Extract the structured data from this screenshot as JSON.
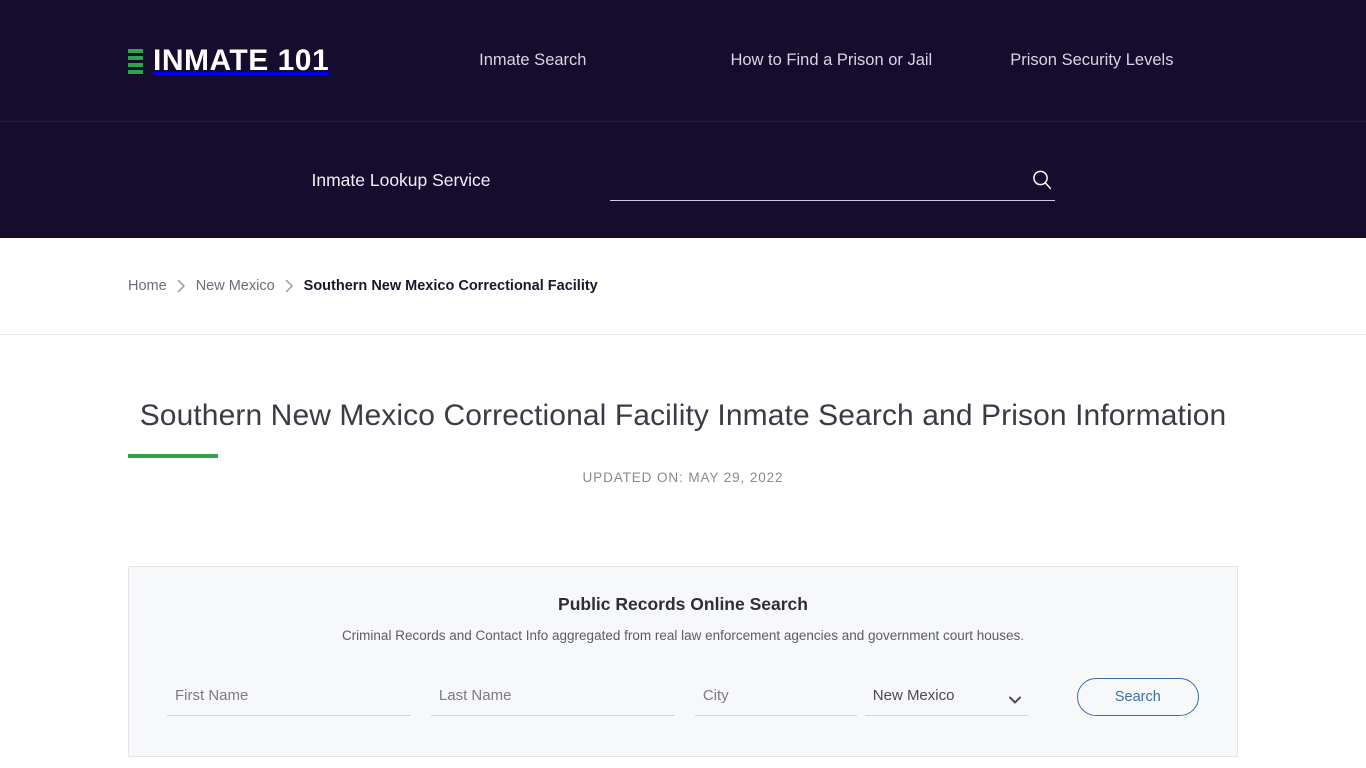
{
  "header": {
    "brand": {
      "name": "INMATE 101",
      "mark_icon": "bars-logo-icon",
      "mark_color": "#2ea44f"
    },
    "nav": [
      {
        "label": "Inmate Search"
      },
      {
        "label": "How to Find a Prison or Jail"
      },
      {
        "label": "Prison Security Levels"
      }
    ]
  },
  "search": {
    "label": "Inmate Lookup Service",
    "value": "",
    "placeholder": "",
    "icon": "search-icon"
  },
  "breadcrumb": {
    "items": [
      {
        "label": "Home",
        "current": false
      },
      {
        "label": "New Mexico",
        "current": false
      },
      {
        "label": "Southern New Mexico Correctional Facility",
        "current": true
      }
    ],
    "separator_icon": "chevron-right-icon"
  },
  "page": {
    "title": "Southern New Mexico Correctional Facility Inmate Search and Prison Information",
    "updated": "UPDATED ON: MAY 29, 2022",
    "accent_color": "#2ea44f"
  },
  "records_panel": {
    "title": "Public Records Online Search",
    "subtitle": "Criminal Records and Contact Info aggregated from real law enforcement agencies and government court houses.",
    "fields": {
      "first_name": {
        "placeholder": "First Name",
        "value": ""
      },
      "last_name": {
        "placeholder": "Last Name",
        "value": ""
      },
      "city": {
        "placeholder": "City",
        "value": ""
      },
      "state": {
        "value": "New Mexico",
        "options": [
          "New Mexico"
        ],
        "caret_icon": "chevron-down-icon"
      }
    },
    "submit_label": "Search",
    "submit_color": "#3b6fa8"
  }
}
